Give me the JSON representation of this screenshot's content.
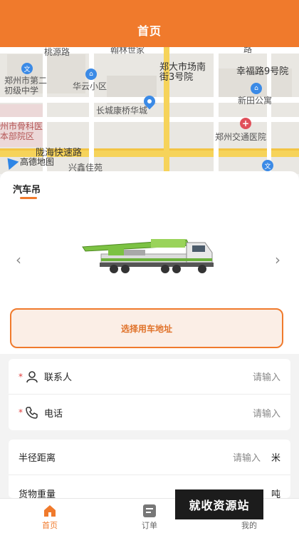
{
  "header": {
    "title": "首页"
  },
  "map": {
    "labels": {
      "taoyuan": "桃源路",
      "hanlin": "翰林世家",
      "road_top": "路",
      "zz_school": "郑州市第二\n初级中学",
      "huayun": "华云小区",
      "market": "郑大市场南\n街3号院",
      "xingfu": "幸福路9号院",
      "xintian": "新田公寓",
      "changcheng": "长城康桥华城",
      "bone_hosp": "州市骨科医\n本部院区",
      "jiaotong_hosp": "郑州交通医院",
      "longhai": "陇海快速路",
      "amap": "高德地图",
      "xingjia": "兴鑫佳苑"
    }
  },
  "category_tab": "汽车吊",
  "carousel": {
    "prev": "‹",
    "next": "›"
  },
  "address_button": "选择用车地址",
  "contact": {
    "name_label": "联系人",
    "name_placeholder": "请输入",
    "phone_label": "电话",
    "phone_placeholder": "请输入",
    "required_mark": "*"
  },
  "job": {
    "radius_label": "半径距离",
    "radius_placeholder": "请输入",
    "radius_unit": "米",
    "weight_label": "货物重量",
    "weight_unit": "吨"
  },
  "tabbar": {
    "home": "首页",
    "orders": "订单",
    "mine": "我的"
  },
  "watermark": "就收资源站",
  "colors": {
    "accent": "#f07a2c",
    "required": "#e03c3c"
  }
}
